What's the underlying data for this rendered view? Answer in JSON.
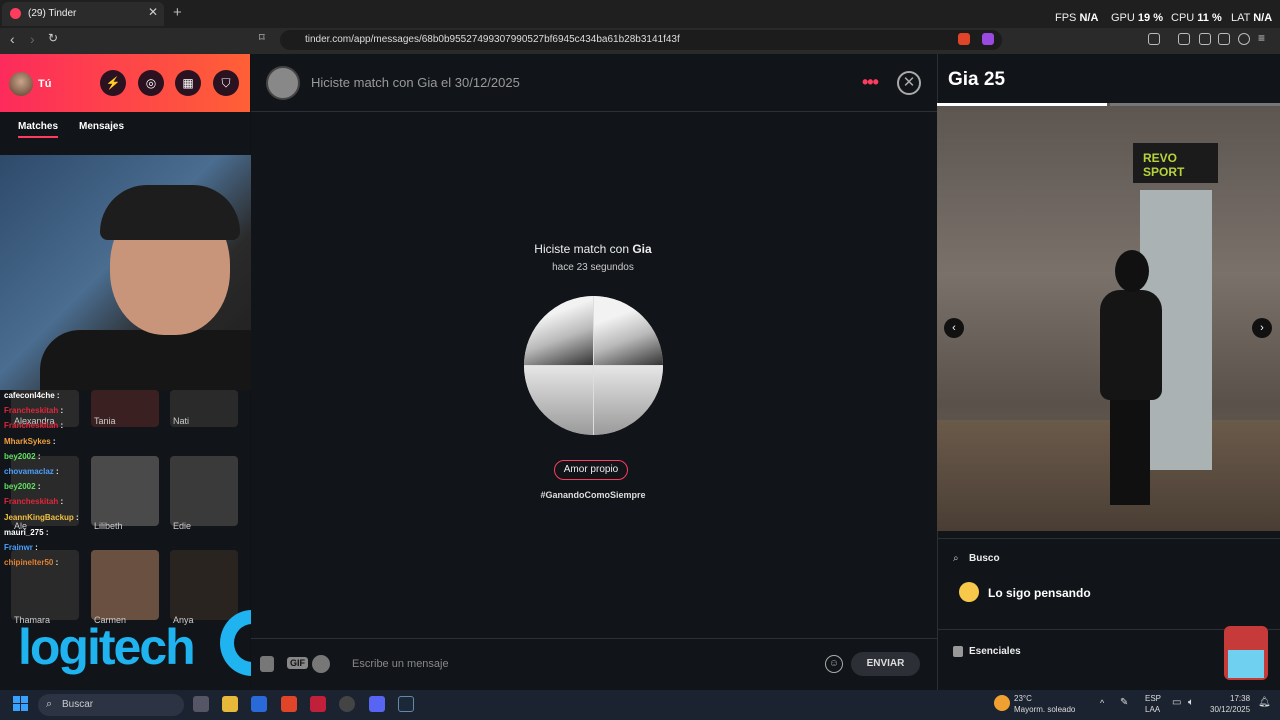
{
  "browser": {
    "tab_title": "(29) Tinder",
    "url": "tinder.com/app/messages/68b0b95527499307990527bf6945c434ba61b28b3141f43f",
    "perf": {
      "fps_label": "FPS",
      "fps_value": "N/A",
      "gpu_label": "GPU",
      "gpu_value": "19 %",
      "cpu_label": "CPU",
      "cpu_value": "11 %",
      "lat_label": "LAT",
      "lat_value": "N/A"
    }
  },
  "sidebar": {
    "user_name": "Tú",
    "tabs": [
      "Matches",
      "Mensajes"
    ],
    "matches": [
      {
        "name": "Alexandra"
      },
      {
        "name": "Tania"
      },
      {
        "name": "Nati"
      },
      {
        "name": "Ale"
      },
      {
        "name": "Lilibeth"
      },
      {
        "name": "Edie"
      },
      {
        "name": "Thamara"
      },
      {
        "name": "Carmen"
      },
      {
        "name": "Anya"
      }
    ],
    "stream_chat": [
      {
        "user": "cafeconl4che",
        "color": "#ffffff"
      },
      {
        "user": "Francheskitah",
        "color": "#e0263a"
      },
      {
        "user": "Francheskitah",
        "color": "#e0263a"
      },
      {
        "user": "MharkSykes",
        "color": "#f0a040"
      },
      {
        "user": "bey2002",
        "color": "#60e060"
      },
      {
        "user": "chovamaclaz",
        "color": "#4aa0ff"
      },
      {
        "user": "bey2002",
        "color": "#60e060"
      },
      {
        "user": "Francheskitah",
        "color": "#e0263a"
      },
      {
        "user": "JeannKingBackup",
        "color": "#f0c040"
      },
      {
        "user": "mauri_275",
        "color": "#ffffff"
      },
      {
        "user": "Frainwr",
        "color": "#4aa0ff"
      },
      {
        "user": "chipinelter50",
        "color": "#e08030"
      }
    ],
    "overlay_logo": "logitech"
  },
  "conversation": {
    "header_title": "Hiciste match con Gia el 30/12/2025",
    "match_heading_prefix": "Hiciste match con",
    "match_heading_name": "Gia",
    "match_time": "hace 23 segundos",
    "interest_tag": "Amor propio",
    "hashtag": "#GanandoComoSiempre",
    "gif_label": "GIF",
    "message_placeholder": "Escribe un mensaje",
    "send_label": "ENVIAR"
  },
  "profile": {
    "name_age": "Gia 25",
    "photo_sign": "REVO SPORT",
    "looking_for_title": "Busco",
    "looking_for_value": "Lo sigo pensando",
    "essentials_title": "Esenciales"
  },
  "taskbar": {
    "search_label": "Buscar",
    "weather_temp": "23°C",
    "weather_desc": "Mayorm. soleado",
    "lang_line1": "ESP",
    "lang_line2": "LAA",
    "time": "17:38",
    "date": "30/12/2025"
  }
}
